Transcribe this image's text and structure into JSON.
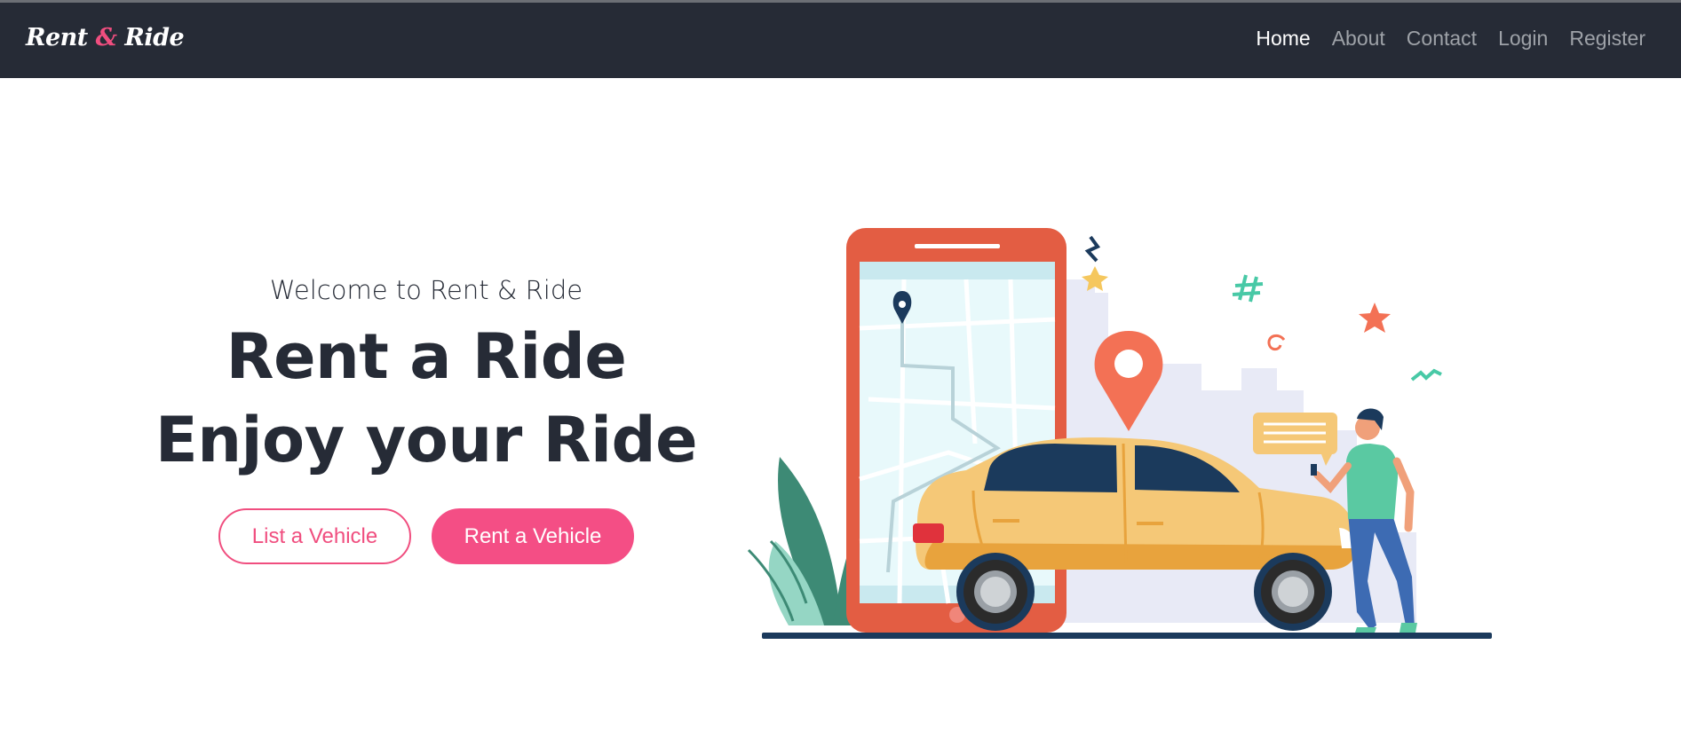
{
  "navbar": {
    "brand": {
      "part1": "Rent",
      "amp": "&",
      "part2": "Ride"
    },
    "links": [
      {
        "label": "Home",
        "active": true
      },
      {
        "label": "About",
        "active": false
      },
      {
        "label": "Contact",
        "active": false
      },
      {
        "label": "Login",
        "active": false
      },
      {
        "label": "Register",
        "active": false
      }
    ]
  },
  "hero": {
    "welcome": "Welcome to Rent & Ride",
    "headline_line1": "Rent a Ride",
    "headline_line2": "Enjoy your Ride",
    "list_button": "List a Vehicle",
    "rent_button": "Rent a Vehicle"
  },
  "colors": {
    "navbar_bg": "#262b36",
    "accent": "#f44e85",
    "text_dark": "#262b36",
    "phone": "#e35d43",
    "car": "#f5c877"
  },
  "illustration": {
    "icon": "car-rental-illustration"
  }
}
